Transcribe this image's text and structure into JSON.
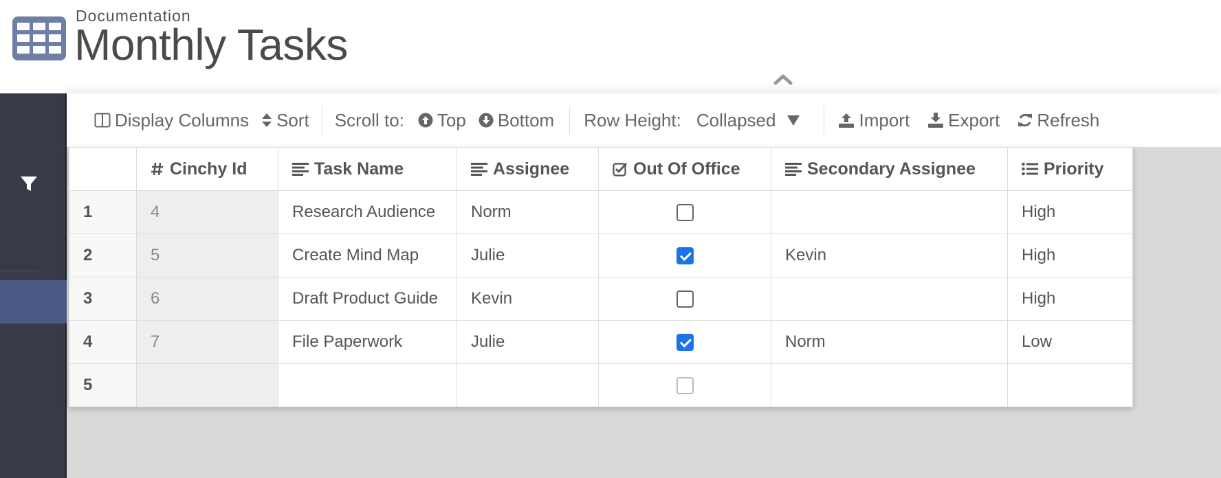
{
  "header": {
    "breadcrumb": "Documentation",
    "title": "Monthly Tasks"
  },
  "toolbar": {
    "display_columns": "Display Columns",
    "sort": "Sort",
    "scroll_to": "Scroll to:",
    "top": "Top",
    "bottom": "Bottom",
    "row_height_label": "Row Height:",
    "row_height_value": "Collapsed",
    "import": "Import",
    "export": "Export",
    "refresh": "Refresh"
  },
  "grid": {
    "columns": [
      {
        "label": "Cinchy Id",
        "icon": "hash-icon"
      },
      {
        "label": "Task Name",
        "icon": "text-align-icon"
      },
      {
        "label": "Assignee",
        "icon": "text-align-icon"
      },
      {
        "label": "Out Of Office",
        "icon": "checkbox-icon"
      },
      {
        "label": "Secondary Assignee",
        "icon": "text-align-icon"
      },
      {
        "label": "Priority",
        "icon": "list-icon"
      }
    ],
    "rows": [
      {
        "num": "1",
        "id": "4",
        "task": "Research Audience",
        "assignee": "Norm",
        "out_of_office": false,
        "secondary": "",
        "priority": "High"
      },
      {
        "num": "2",
        "id": "5",
        "task": "Create Mind Map",
        "assignee": "Julie",
        "out_of_office": true,
        "secondary": "Kevin",
        "priority": "High"
      },
      {
        "num": "3",
        "id": "6",
        "task": "Draft Product Guide",
        "assignee": "Kevin",
        "out_of_office": false,
        "secondary": "",
        "priority": "High"
      },
      {
        "num": "4",
        "id": "7",
        "task": "File Paperwork",
        "assignee": "Julie",
        "out_of_office": true,
        "secondary": "Norm",
        "priority": "Low"
      },
      {
        "num": "5",
        "id": "",
        "task": "",
        "assignee": "",
        "out_of_office": false,
        "secondary": "",
        "priority": ""
      }
    ]
  },
  "colors": {
    "accent": "#1a73e8",
    "sidebar": "#383a47",
    "sidebar_active": "#4a5a86",
    "logo": "#6d7fa6"
  }
}
